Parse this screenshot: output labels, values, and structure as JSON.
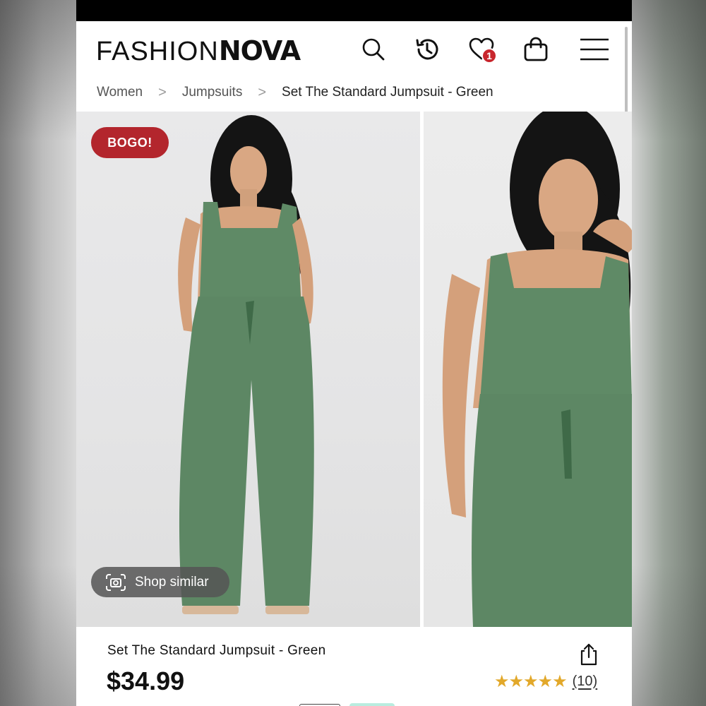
{
  "brand": {
    "logo_light": "FASHION",
    "logo_bold": "NOVA"
  },
  "header": {
    "icons": [
      "search-icon",
      "history-icon",
      "wishlist-heart-icon",
      "shopping-bag-icon",
      "menu-icon"
    ],
    "wishlist_count": "1"
  },
  "breadcrumb": {
    "items": [
      "Women",
      "Jumpsuits"
    ],
    "current": "Set The Standard Jumpsuit - Green",
    "separator": ">"
  },
  "gallery": {
    "badge": "BOGO!",
    "shop_similar_label": "Shop similar",
    "product_color": "#5f8a66"
  },
  "product": {
    "title": "Set The Standard Jumpsuit - Green",
    "price": "$34.99",
    "rating_stars": 5,
    "stars_text": "★★★★★",
    "review_count": "(10)"
  },
  "colors": {
    "accent": "#b3262d",
    "star": "#e2a82a",
    "badge": "#c8262d"
  }
}
